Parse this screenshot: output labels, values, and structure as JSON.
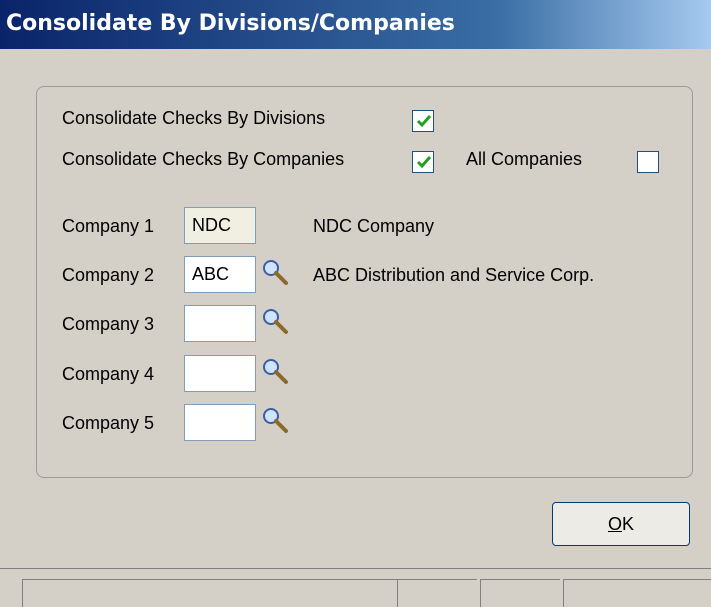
{
  "window": {
    "title": "Consolidate By Divisions/Companies"
  },
  "options": {
    "by_divisions": {
      "label": "Consolidate Checks By Divisions",
      "checked": true
    },
    "by_companies": {
      "label": "Consolidate Checks By Companies",
      "checked": true
    },
    "all_companies": {
      "label": "All Companies",
      "checked": false
    }
  },
  "companies": [
    {
      "label": "Company 1",
      "code": "NDC",
      "name": "NDC Company"
    },
    {
      "label": "Company 2",
      "code": "ABC",
      "name": "ABC Distribution and Service Corp."
    },
    {
      "label": "Company 3",
      "code": "",
      "name": ""
    },
    {
      "label": "Company 4",
      "code": "",
      "name": ""
    },
    {
      "label": "Company 5",
      "code": "",
      "name": ""
    }
  ],
  "buttons": {
    "ok_label": "OK"
  }
}
